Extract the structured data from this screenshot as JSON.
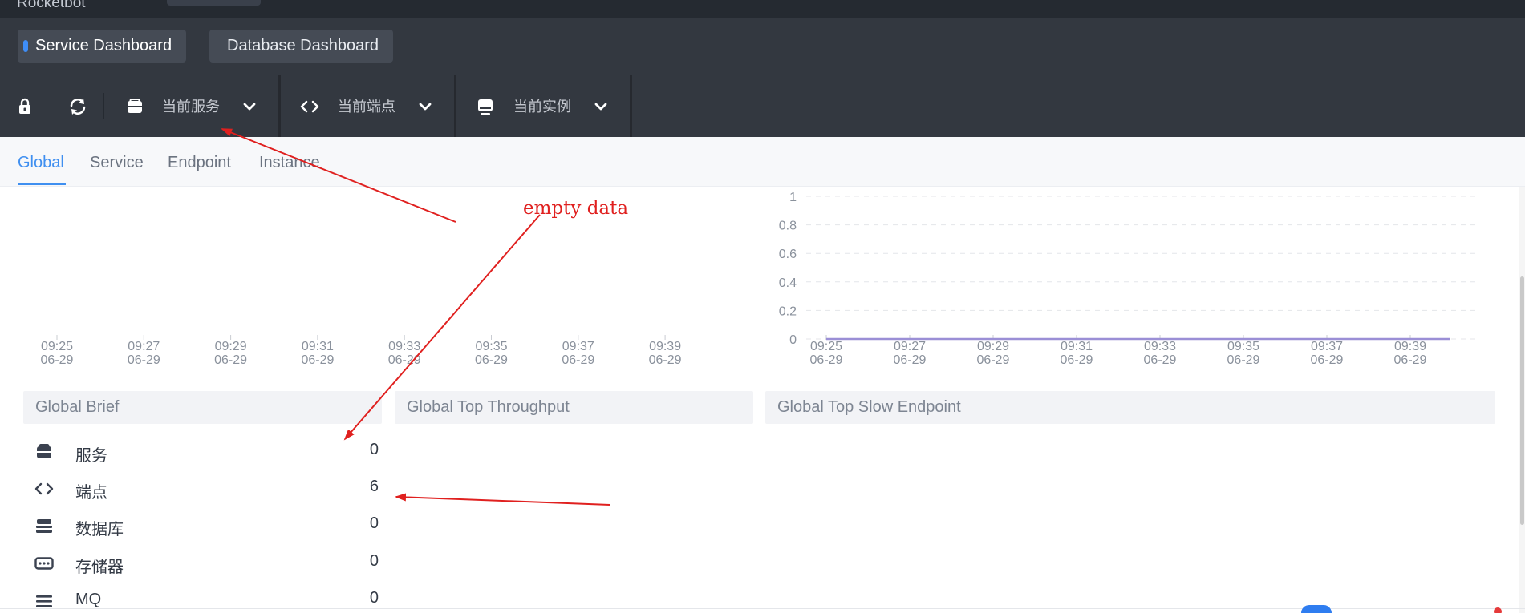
{
  "app": {
    "brand": "Rocketbot"
  },
  "dashboards": [
    {
      "label": "Service Dashboard",
      "active": true
    },
    {
      "label": "Database Dashboard",
      "active": false
    }
  ],
  "toolbar": {
    "icons": [
      "lock-icon",
      "refresh-icon"
    ],
    "selectors": [
      {
        "icon": "service-icon",
        "label": "当前服务"
      },
      {
        "icon": "endpoint-icon",
        "label": "当前端点"
      },
      {
        "icon": "instance-icon",
        "label": "当前实例"
      }
    ]
  },
  "subtabs": [
    {
      "label": "Global",
      "active": true
    },
    {
      "label": "Service",
      "active": false
    },
    {
      "label": "Endpoint",
      "active": false
    },
    {
      "label": "Instance",
      "active": false
    }
  ],
  "charts": {
    "left": {
      "x_ticks": [
        {
          "time": "09:25",
          "date": "06-29"
        },
        {
          "time": "09:27",
          "date": "06-29"
        },
        {
          "time": "09:29",
          "date": "06-29"
        },
        {
          "time": "09:31",
          "date": "06-29"
        },
        {
          "time": "09:33",
          "date": "06-29"
        },
        {
          "time": "09:35",
          "date": "06-29"
        },
        {
          "time": "09:37",
          "date": "06-29"
        },
        {
          "time": "09:39",
          "date": "06-29"
        }
      ]
    },
    "right": {
      "y_ticks": [
        "1",
        "0.8",
        "0.6",
        "0.4",
        "0.2",
        "0"
      ],
      "x_ticks": [
        {
          "time": "09:25",
          "date": "06-29"
        },
        {
          "time": "09:27",
          "date": "06-29"
        },
        {
          "time": "09:29",
          "date": "06-29"
        },
        {
          "time": "09:31",
          "date": "06-29"
        },
        {
          "time": "09:33",
          "date": "06-29"
        },
        {
          "time": "09:35",
          "date": "06-29"
        },
        {
          "time": "09:37",
          "date": "06-29"
        },
        {
          "time": "09:39",
          "date": "06-29"
        }
      ],
      "series_color": "#9b8fd6",
      "series_value": 0
    }
  },
  "panels": {
    "brief_title": "Global Brief",
    "throughput_title": "Global Top Throughput",
    "slow_title": "Global Top Slow Endpoint"
  },
  "brief": [
    {
      "icon": "service-icon",
      "label": "服务",
      "value": "0"
    },
    {
      "icon": "endpoint-icon",
      "label": "端点",
      "value": "6"
    },
    {
      "icon": "database-icon",
      "label": "数据库",
      "value": "0"
    },
    {
      "icon": "storage-icon",
      "label": "存储器",
      "value": "0"
    },
    {
      "icon": "mq-icon",
      "label": "MQ",
      "value": "0"
    }
  ],
  "annotation": {
    "text": "empty data",
    "color": "#e0201f"
  },
  "colors": {
    "accent": "#3f8ff0",
    "header_bg": "#333840"
  }
}
